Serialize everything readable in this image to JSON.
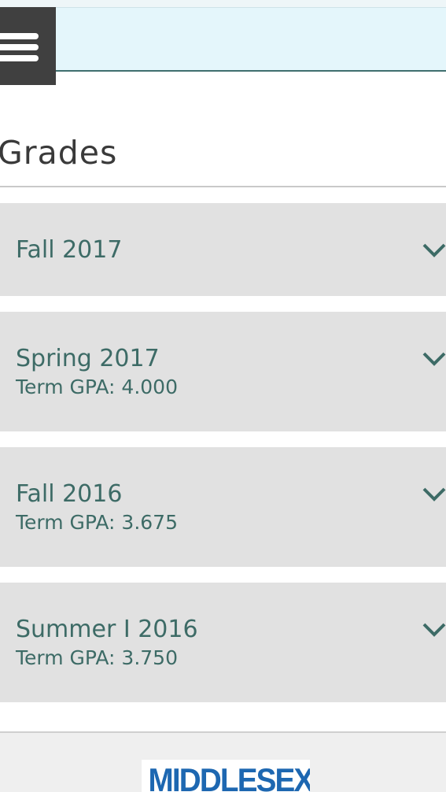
{
  "header": {
    "menu_icon": "hamburger-menu-icon"
  },
  "page": {
    "title": "Grades"
  },
  "terms": [
    {
      "name": "Fall 2017",
      "gpa": ""
    },
    {
      "name": "Spring 2017",
      "gpa": "Term GPA: 4.000"
    },
    {
      "name": "Fall 2016",
      "gpa": "Term GPA: 3.675"
    },
    {
      "name": "Summer I 2016",
      "gpa": "Term GPA: 3.750"
    }
  ],
  "footer": {
    "logo_text": "MIDDLESEX"
  },
  "colors": {
    "accent": "#3d6b66",
    "panel": "#e1e1e1",
    "header_bg": "#e4f6fb",
    "menu_bg": "#404040",
    "logo": "#1d67b1"
  }
}
